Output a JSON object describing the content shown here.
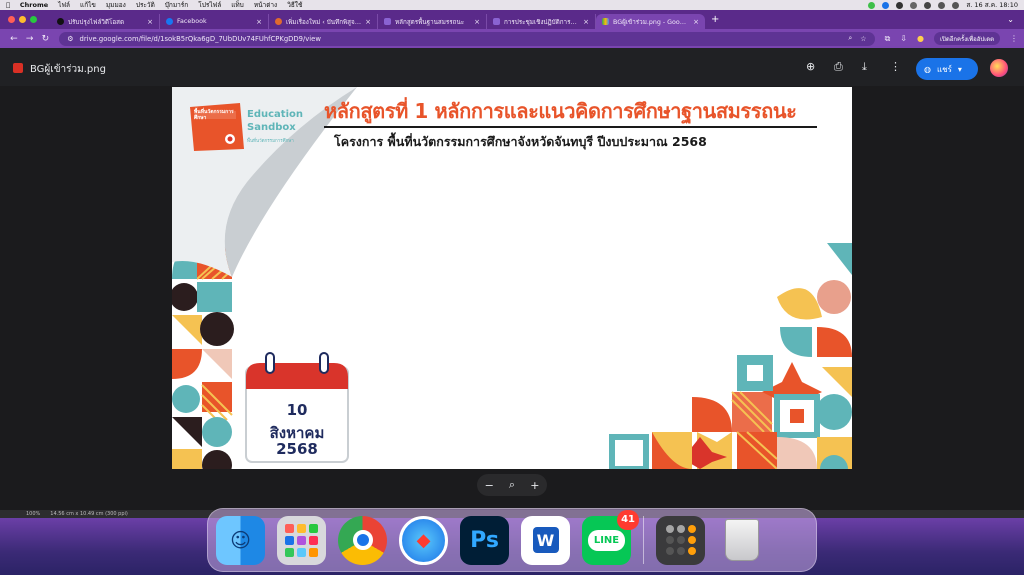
{
  "menubar": {
    "app": "Chrome",
    "items": [
      "ไฟล์",
      "แก้ไข",
      "มุมมอง",
      "ประวัติ",
      "บุ๊กมาร์ก",
      "โปรไฟล์",
      "แท็บ",
      "หน้าต่าง",
      "วิธีใช้"
    ],
    "clock": "ส. 16 ส.ค.  18:10"
  },
  "tabs": [
    {
      "title": "ปรับปรุงไฟล์วิดีโอสด",
      "active": false
    },
    {
      "title": "Facebook",
      "active": false
    },
    {
      "title": "เพิ่มเรื่องใหม่ ‹ บันทึกพิสูจน์ความรู้",
      "active": false
    },
    {
      "title": "หลักสูตรพื้นฐานสมรรถนะ",
      "active": false
    },
    {
      "title": "การประชุมเชิงปฏิบัติการประเมินฯ",
      "active": false
    },
    {
      "title": "BGผู้เข้าร่วม.png - Google ไดรฟ์",
      "active": true
    }
  ],
  "toolbar": {
    "url": "drive.google.com/file/d/1sokB5rQka6gD_7UbDUv74FUhfCPKgDD9/view",
    "relaunch_label": "เปิดอีกครั้งเพื่ออัปเดต"
  },
  "viewer": {
    "filename": "BGผู้เข้าร่วม.png",
    "share_label": "แชร์"
  },
  "slide": {
    "logo_title_th": "พื้นที่นวัตกรรมการศึกษา",
    "logo_en_1": "Education",
    "logo_en_2": "Sandbox",
    "logo_sub": "พื้นที่นวัตกรรมการศึกษา",
    "title": "หลักสูตรที่ 1 หลักการและแนวคิดการศึกษาฐานสมรรถนะ",
    "subtitle": "โครงการ พื้นที่นวัตกรรมการศึกษาจังหวัดจันทบุรี ปีงบประมาณ 2568",
    "date_day": "10",
    "date_month": "สิงหาคม",
    "date_year": "2568",
    "colors": {
      "orange": "#e8542a",
      "teal": "#5fb5b8",
      "navy": "#1f2b5e",
      "yellow": "#f5c252",
      "red": "#d9342b",
      "dark": "#2b1d1e"
    }
  },
  "statusstrip": {
    "zoom": "100%",
    "doc_info": "14.56 cm x 10.49 cm (300 ppi)"
  },
  "dock": {
    "apps": [
      "finder-icon",
      "launchpad-icon",
      "chrome-icon",
      "safari-icon",
      "photoshop-icon",
      "word-icon",
      "line-icon",
      "calculator-icon",
      "trash-icon"
    ],
    "ps_label": "Ps",
    "word_label": "W",
    "line_label": "LINE",
    "line_badge": "41"
  }
}
